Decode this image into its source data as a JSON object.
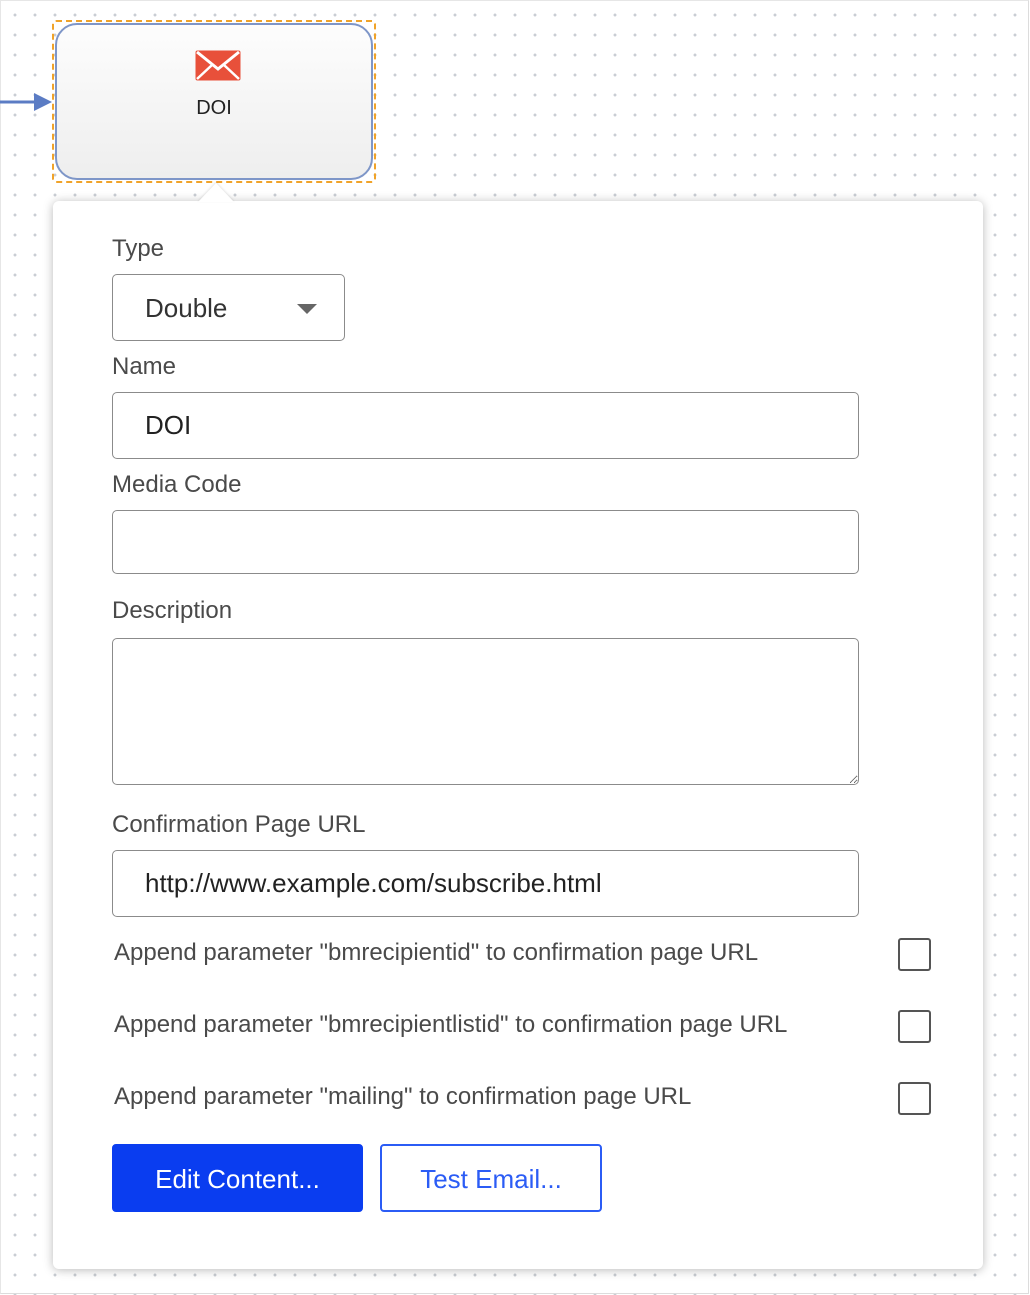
{
  "node": {
    "label": "DOI",
    "icon": "envelope-icon",
    "icon_color": "#e8503a"
  },
  "panel": {
    "type": {
      "label": "Type",
      "value": "Double"
    },
    "name": {
      "label": "Name",
      "value": "DOI"
    },
    "media_code": {
      "label": "Media Code",
      "value": ""
    },
    "description": {
      "label": "Description",
      "value": ""
    },
    "confirmation_url": {
      "label": "Confirmation Page URL",
      "value": "http://www.example.com/subscribe.html"
    },
    "options": [
      {
        "label": "Append parameter \"bmrecipientid\" to confirmation page URL",
        "checked": false
      },
      {
        "label": "Append parameter \"bmrecipientlistid\" to confirmation page URL",
        "checked": false
      },
      {
        "label": "Append parameter \"mailing\" to confirmation page URL",
        "checked": false
      }
    ],
    "buttons": {
      "edit_content": "Edit Content...",
      "test_email": "Test Email..."
    }
  },
  "colors": {
    "primary": "#0a3df0",
    "node_border": "#7e96c8",
    "selection_dash": "#f0a32a",
    "connector": "#5b7cc4"
  }
}
